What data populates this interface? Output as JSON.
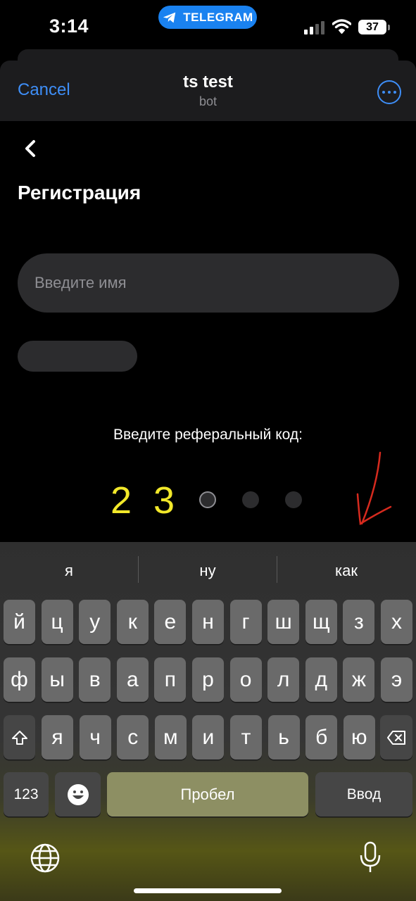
{
  "status_bar": {
    "time": "3:14",
    "pill_label": "TELEGRAM",
    "battery": "37"
  },
  "header": {
    "cancel_label": "Cancel",
    "title": "ts test",
    "subtitle": "bot"
  },
  "page": {
    "title": "Регистрация",
    "name_placeholder": "Введите имя",
    "referral_label": "Введите реферальный код:",
    "code_digits": [
      "2",
      "3"
    ],
    "code_length": 5
  },
  "keyboard": {
    "suggestions": [
      "я",
      "ну",
      "как"
    ],
    "row1": [
      "й",
      "ц",
      "у",
      "к",
      "е",
      "н",
      "г",
      "ш",
      "щ",
      "з",
      "х"
    ],
    "row2": [
      "ф",
      "ы",
      "в",
      "а",
      "п",
      "р",
      "о",
      "л",
      "д",
      "ж",
      "э"
    ],
    "row3": [
      "я",
      "ч",
      "с",
      "м",
      "и",
      "т",
      "ь",
      "б",
      "ю"
    ],
    "numbers_label": "123",
    "space_label": "Пробел",
    "return_label": "Ввод"
  },
  "colors": {
    "accent": "#3e8ef7",
    "code_digit": "#f2e82a",
    "telegram": "#1a82f0",
    "annotation_arrow": "#d62a1e"
  },
  "icons": [
    "telegram-icon",
    "signal-icon",
    "wifi-icon",
    "battery-icon",
    "more-icon",
    "back-chevron-icon",
    "shift-icon",
    "backspace-icon",
    "emoji-icon",
    "globe-icon",
    "mic-icon"
  ]
}
